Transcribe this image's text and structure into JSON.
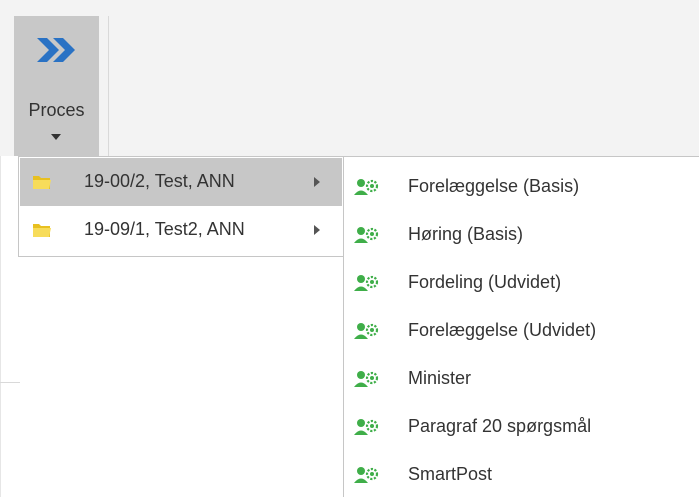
{
  "ribbon": {
    "proces_button": {
      "label": "Proces",
      "icon": "double-chevron-right-icon",
      "icon_color": "#2a72c4"
    }
  },
  "menu": {
    "items": [
      {
        "label": "19-00/2, Test, ANN",
        "icon": "folder-icon",
        "has_submenu": true,
        "active": true
      },
      {
        "label": "19-09/1, Test2, ANN",
        "icon": "folder-icon",
        "has_submenu": true,
        "active": false
      }
    ]
  },
  "submenu": {
    "icon": "people-gear-icon",
    "icon_color": "#3fae49",
    "items": [
      {
        "label": "Forelæggelse (Basis)"
      },
      {
        "label": "Høring (Basis)"
      },
      {
        "label": "Fordeling (Udvidet)"
      },
      {
        "label": "Forelæggelse (Udvidet)"
      },
      {
        "label": "Minister"
      },
      {
        "label": "Paragraf 20 spørgsmål"
      },
      {
        "label": "SmartPost"
      }
    ]
  }
}
